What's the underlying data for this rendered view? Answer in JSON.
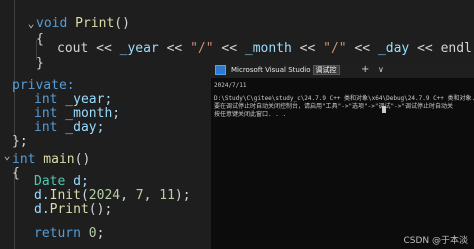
{
  "editor": {
    "lines": {
      "print_sig_kw": "void",
      "print_sig_name": "Print",
      "print_sig_rest": "()",
      "open_brace": "{",
      "cout_a": "cout << ",
      "cout_year": "_year",
      "cout_b": " << ",
      "cout_sep1": "\"/\"",
      "cout_c": " << ",
      "cout_month": "_month",
      "cout_d": " << ",
      "cout_sep2": "\"/\"",
      "cout_e": " << ",
      "cout_day": "_day",
      "cout_f": " << endl;",
      "close_brace": "}",
      "private_label": "private:",
      "int1": "int",
      "member1": " _year;",
      "int2": "int",
      "member2": " _month;",
      "int3": "int",
      "member3": " _day;",
      "class_end": "};",
      "main_int": "int",
      "main_name": " main",
      "main_rest": "()",
      "main_open": "{",
      "date_type": "Date",
      "date_var": " d;",
      "init_obj": "d.",
      "init_fn": "Init",
      "init_open": "(",
      "init_n1": "2024",
      "init_c1": ", ",
      "init_n2": "7",
      "init_c2": ", ",
      "init_n3": "11",
      "init_close": ");",
      "print_obj": "d.",
      "print_fn": "Print",
      "print_close": "();",
      "return_kw": "return",
      "return_val": "0",
      "return_semi": ";"
    }
  },
  "console": {
    "title": "Microsoft Visual Studio",
    "title_badge": "调试控",
    "new_tab": "+",
    "dropdown": "∨",
    "output_lines": [
      "2024/7/11",
      "D:\\Study\\C\\gitee\\study_c\\24.7.9 C++ 类和对象\\x64\\Debug\\24.7.9 C++ 类和对象.exe",
      "要在调试停止时自动关闭控制台，请启用\"工具\"->\"选项\"->\"调试\"->\"调试停止时自动关",
      "按任意键关闭此窗口. . ."
    ]
  },
  "watermark": "CSDN @于本淡"
}
